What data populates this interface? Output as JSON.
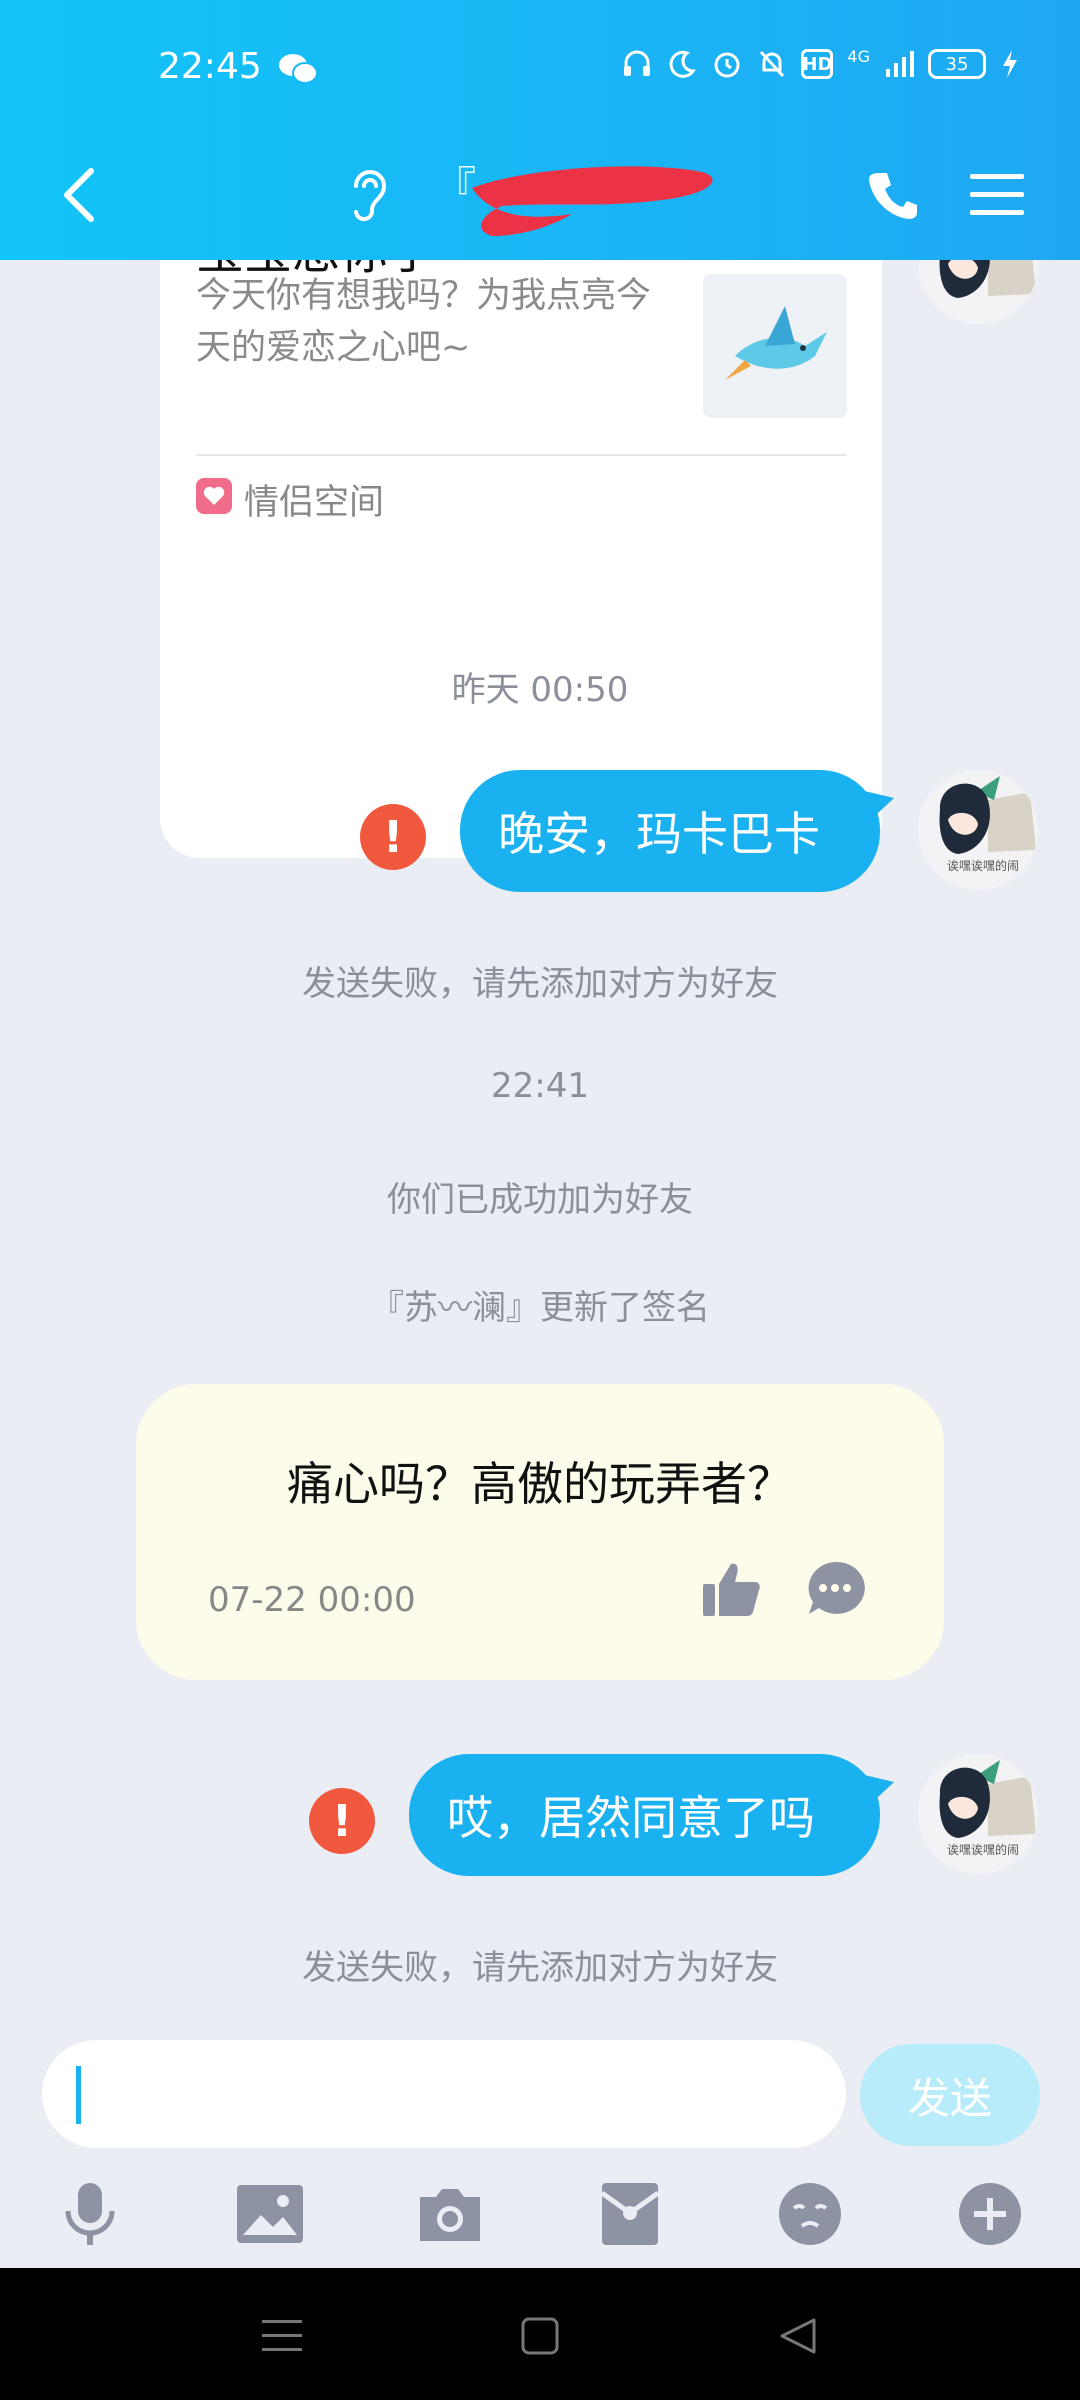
{
  "status_bar": {
    "time": "22:45",
    "network": "4G",
    "hd": "HD",
    "battery": "35",
    "icons": [
      "wechat-icon",
      "headphones-icon",
      "moon-icon",
      "alarm-icon",
      "mute-bell-icon",
      "signal-icon",
      "charging-icon"
    ]
  },
  "nav": {
    "title_visible": "『",
    "icons": [
      "back-icon",
      "ear-icon",
      "phone-icon",
      "menu-icon"
    ]
  },
  "card": {
    "title": "宝宝想你了",
    "description": "今天你有想我吗？为我点亮今天的爱恋之心吧~",
    "tag": "情侣空间"
  },
  "messages": {
    "timestamp_1": "昨天 00:50",
    "bubble_1": "晚安，玛卡巴卡",
    "failed_1": "发送失败，请先添加对方为好友",
    "timestamp_2": "22:41",
    "notice_friends": "你们已成功加为好友",
    "notice_signature": "『苏〰澜』更新了签名",
    "bubble_2": "哎，居然同意了吗",
    "failed_2": "发送失败，请先添加对方为好友",
    "avatar_caption": "诶嘿诶嘿的闹"
  },
  "signature_card": {
    "text": "痛心吗？高傲的玩弄者？",
    "date": "07-22 00:00"
  },
  "input": {
    "value": "",
    "send_label": "发送"
  },
  "toolbar": [
    "mic-icon",
    "image-icon",
    "camera-icon",
    "red-packet-icon",
    "emoji-icon",
    "plus-icon"
  ],
  "colors": {
    "header_start": "#12c5f8",
    "header_end": "#1fa8f2",
    "bubble": "#19b1f0",
    "error": "#f1593e",
    "background": "#ebedf5",
    "signature_bg": "#fdfbea"
  }
}
